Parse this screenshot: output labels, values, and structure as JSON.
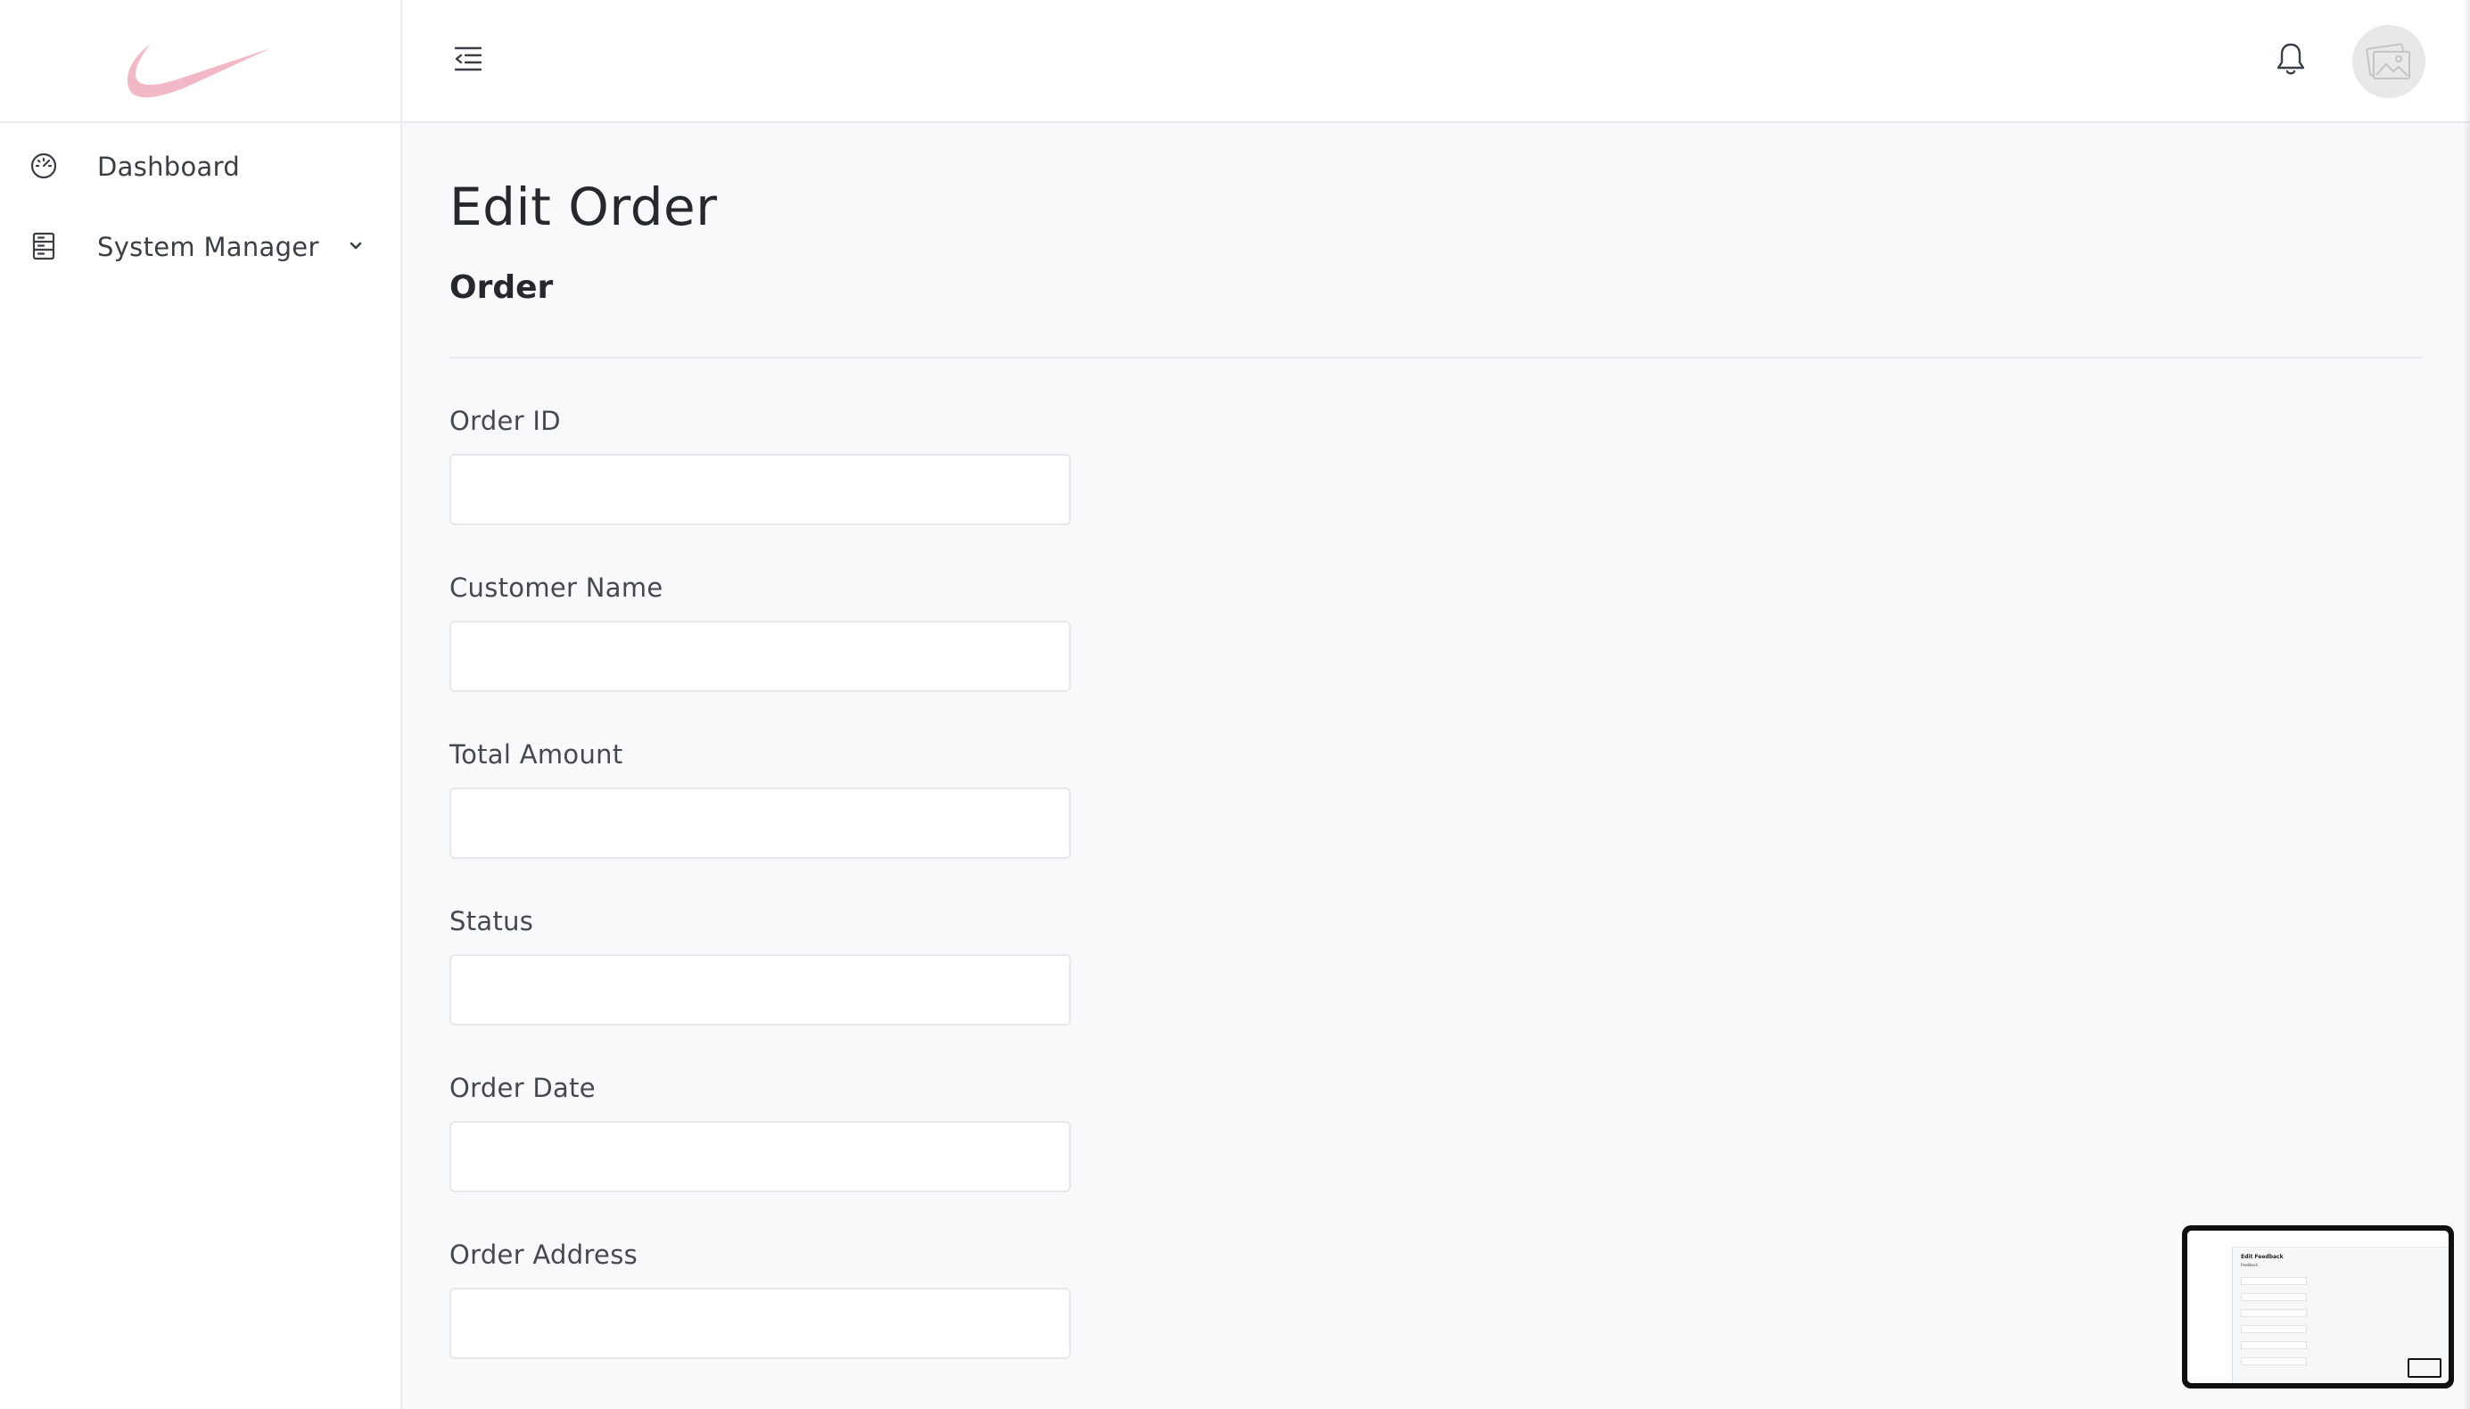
{
  "app": {
    "logo": "swoosh-logo"
  },
  "sidebar": {
    "items": [
      {
        "label": "Dashboard",
        "icon": "dashboard-gauge-icon"
      },
      {
        "label": "System Manager",
        "icon": "server-icon",
        "expand_icon": "chevron-down-icon"
      }
    ]
  },
  "header": {
    "menu_icon": "collapse-menu-icon",
    "notification_icon": "bell-icon",
    "avatar_icon": "image-placeholder-icon"
  },
  "main": {
    "page_title": "Edit Order",
    "section_title": "Order",
    "fields": [
      {
        "label": "Order ID",
        "value": ""
      },
      {
        "label": "Customer Name",
        "value": ""
      },
      {
        "label": "Total Amount",
        "value": ""
      },
      {
        "label": "Status",
        "value": ""
      },
      {
        "label": "Order Date",
        "value": ""
      },
      {
        "label": "Order Address",
        "value": ""
      }
    ]
  },
  "preview": {
    "title": "Edit Feedback",
    "subtitle": "Feedback"
  },
  "colors": {
    "logo": "#f2b8c6",
    "background": "#f8f9fb",
    "border": "#e6e8ec"
  }
}
